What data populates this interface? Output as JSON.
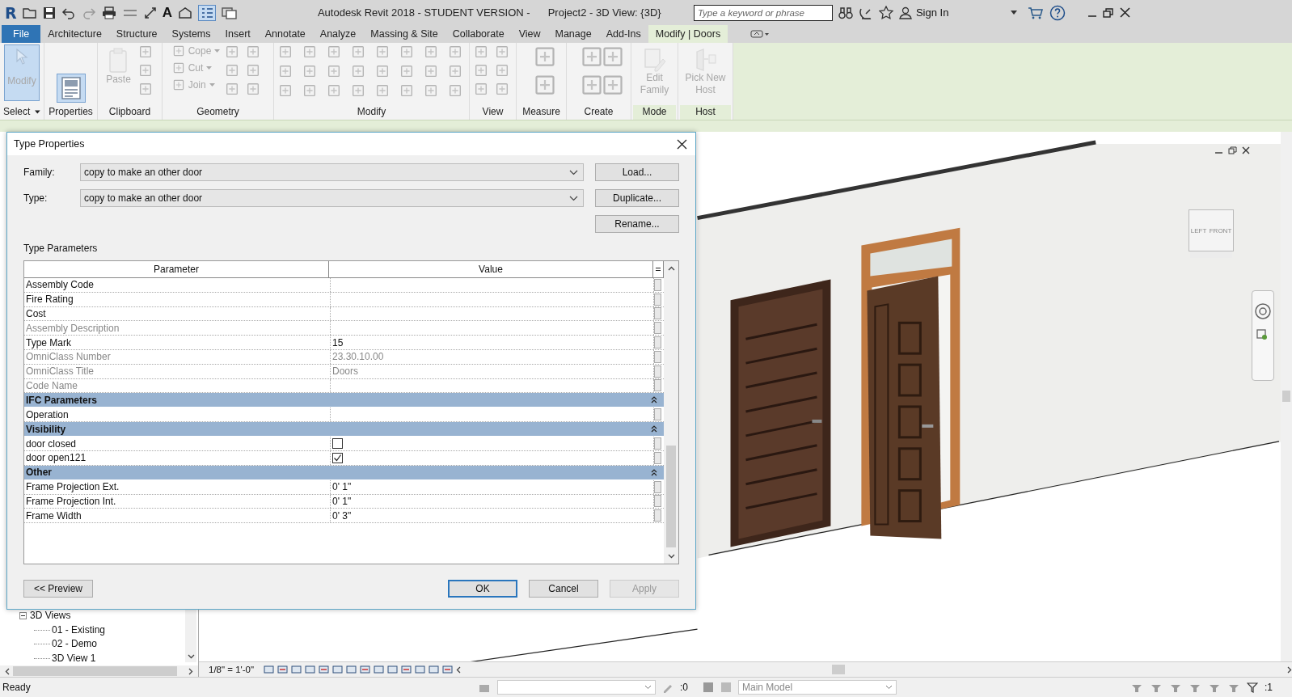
{
  "window": {
    "logo": "R",
    "text_tool": "A",
    "title": "Autodesk Revit 2018 - STUDENT VERSION -",
    "document": "Project2 - 3D View: {3D}"
  },
  "search": {
    "placeholder": "Type a keyword or phrase"
  },
  "account": {
    "label": "Sign In"
  },
  "tabs": [
    {
      "label": "File",
      "kind": "file",
      "selected": false
    },
    {
      "label": "Architecture",
      "kind": "normal",
      "selected": false
    },
    {
      "label": "Structure",
      "kind": "normal",
      "selected": false
    },
    {
      "label": "Systems",
      "kind": "normal",
      "selected": false
    },
    {
      "label": "Insert",
      "kind": "normal",
      "selected": false
    },
    {
      "label": "Annotate",
      "kind": "normal",
      "selected": false
    },
    {
      "label": "Analyze",
      "kind": "normal",
      "selected": false
    },
    {
      "label": "Massing & Site",
      "kind": "normal",
      "selected": false
    },
    {
      "label": "Collaborate",
      "kind": "normal",
      "selected": false
    },
    {
      "label": "View",
      "kind": "normal",
      "selected": false
    },
    {
      "label": "Manage",
      "kind": "normal",
      "selected": false
    },
    {
      "label": "Add-Ins",
      "kind": "normal",
      "selected": false
    },
    {
      "label": "Modify | Doors",
      "kind": "contextual",
      "selected": true
    }
  ],
  "ribbon": {
    "panels": [
      {
        "kind": "select",
        "title": "Select",
        "contextual": false,
        "tools": [
          {
            "label": "Modify",
            "active": true,
            "disabled": true
          }
        ]
      },
      {
        "kind": "properties",
        "title": "Properties",
        "contextual": false,
        "tools": [
          {
            "active": true,
            "disabled": false
          }
        ]
      },
      {
        "kind": "clipboard",
        "title": "Clipboard",
        "contextual": false,
        "tools": [
          {
            "label": "Paste",
            "active": false,
            "disabled": true
          }
        ]
      },
      {
        "kind": "geometry",
        "title": "Geometry",
        "contextual": false,
        "tools": [
          {
            "label": "Cope",
            "active": false,
            "disabled": true
          },
          {
            "label": "Cut",
            "active": false,
            "disabled": true
          },
          {
            "label": "Join",
            "active": false,
            "disabled": true
          }
        ]
      },
      {
        "kind": "modify",
        "title": "Modify",
        "contextual": false
      },
      {
        "kind": "view",
        "title": "View",
        "contextual": false
      },
      {
        "kind": "measure",
        "title": "Measure",
        "contextual": false
      },
      {
        "kind": "create",
        "title": "Create",
        "contextual": false
      },
      {
        "kind": "mode",
        "title": "Mode",
        "contextual": true,
        "tools": [
          {
            "label": "Edit Family",
            "active": false,
            "disabled": true
          }
        ]
      },
      {
        "kind": "host",
        "title": "Host",
        "contextual": true,
        "tools": [
          {
            "label": "Pick New Host",
            "active": false,
            "disabled": true
          }
        ]
      }
    ]
  },
  "browser": {
    "tree": [
      {
        "label": "3D Views",
        "expanded": true,
        "children": [
          {
            "label": "01 - Existing"
          },
          {
            "label": "02 - Demo"
          },
          {
            "label": "3D View 1"
          }
        ]
      }
    ]
  },
  "view": {
    "cube_faces": [
      "LEFT",
      "FRONT"
    ],
    "scale": "1/8\" = 1'-0\""
  },
  "dialog": {
    "title": "Type Properties",
    "family": {
      "label": "Family:",
      "value": "copy to make an other door"
    },
    "type": {
      "label": "Type:",
      "value": "copy to make an other door"
    },
    "side_buttons": [
      "Load...",
      "Duplicate...",
      "Rename..."
    ],
    "section_label": "Type Parameters",
    "table": {
      "columns": [
        "Parameter",
        "Value"
      ],
      "rows": [
        {
          "kind": "param",
          "name": "Assembly Code",
          "disabled": false
        },
        {
          "kind": "param",
          "name": "Fire Rating",
          "disabled": false
        },
        {
          "kind": "param",
          "name": "Cost",
          "disabled": false
        },
        {
          "kind": "param",
          "name": "Assembly Description",
          "disabled": true
        },
        {
          "kind": "param",
          "name": "Type Mark",
          "value": "15",
          "disabled": false
        },
        {
          "kind": "param",
          "name": "OmniClass Number",
          "value": "23.30.10.00",
          "disabled": true
        },
        {
          "kind": "param",
          "name": "OmniClass Title",
          "value": "Doors",
          "disabled": true
        },
        {
          "kind": "param",
          "name": "Code Name",
          "disabled": true
        },
        {
          "kind": "group",
          "name": "IFC Parameters",
          "expanded": true
        },
        {
          "kind": "param",
          "name": "Operation",
          "disabled": false
        },
        {
          "kind": "group",
          "name": "Visibility",
          "expanded": true
        },
        {
          "kind": "checkbox",
          "name": "door closed",
          "checked": false
        },
        {
          "kind": "checkbox",
          "name": "door open121",
          "checked": true
        },
        {
          "kind": "group",
          "name": "Other",
          "expanded": true
        },
        {
          "kind": "param",
          "name": "Frame Projection Ext.",
          "value": "0'  1\"",
          "disabled": false
        },
        {
          "kind": "param",
          "name": "Frame Projection Int.",
          "value": "0'  1\"",
          "disabled": false
        },
        {
          "kind": "param",
          "name": "Frame Width",
          "value": "0'  3\"",
          "disabled": false
        }
      ]
    },
    "preview_button": "<< Preview",
    "buttons": [
      {
        "label": "OK",
        "default": true,
        "disabled": false
      },
      {
        "label": "Cancel",
        "default": false,
        "disabled": false
      },
      {
        "label": "Apply",
        "default": false,
        "disabled": true
      }
    ]
  },
  "status_bar": {
    "message": "Ready",
    "count_left": ":0",
    "model": "Main Model",
    "count_right": ":1"
  }
}
